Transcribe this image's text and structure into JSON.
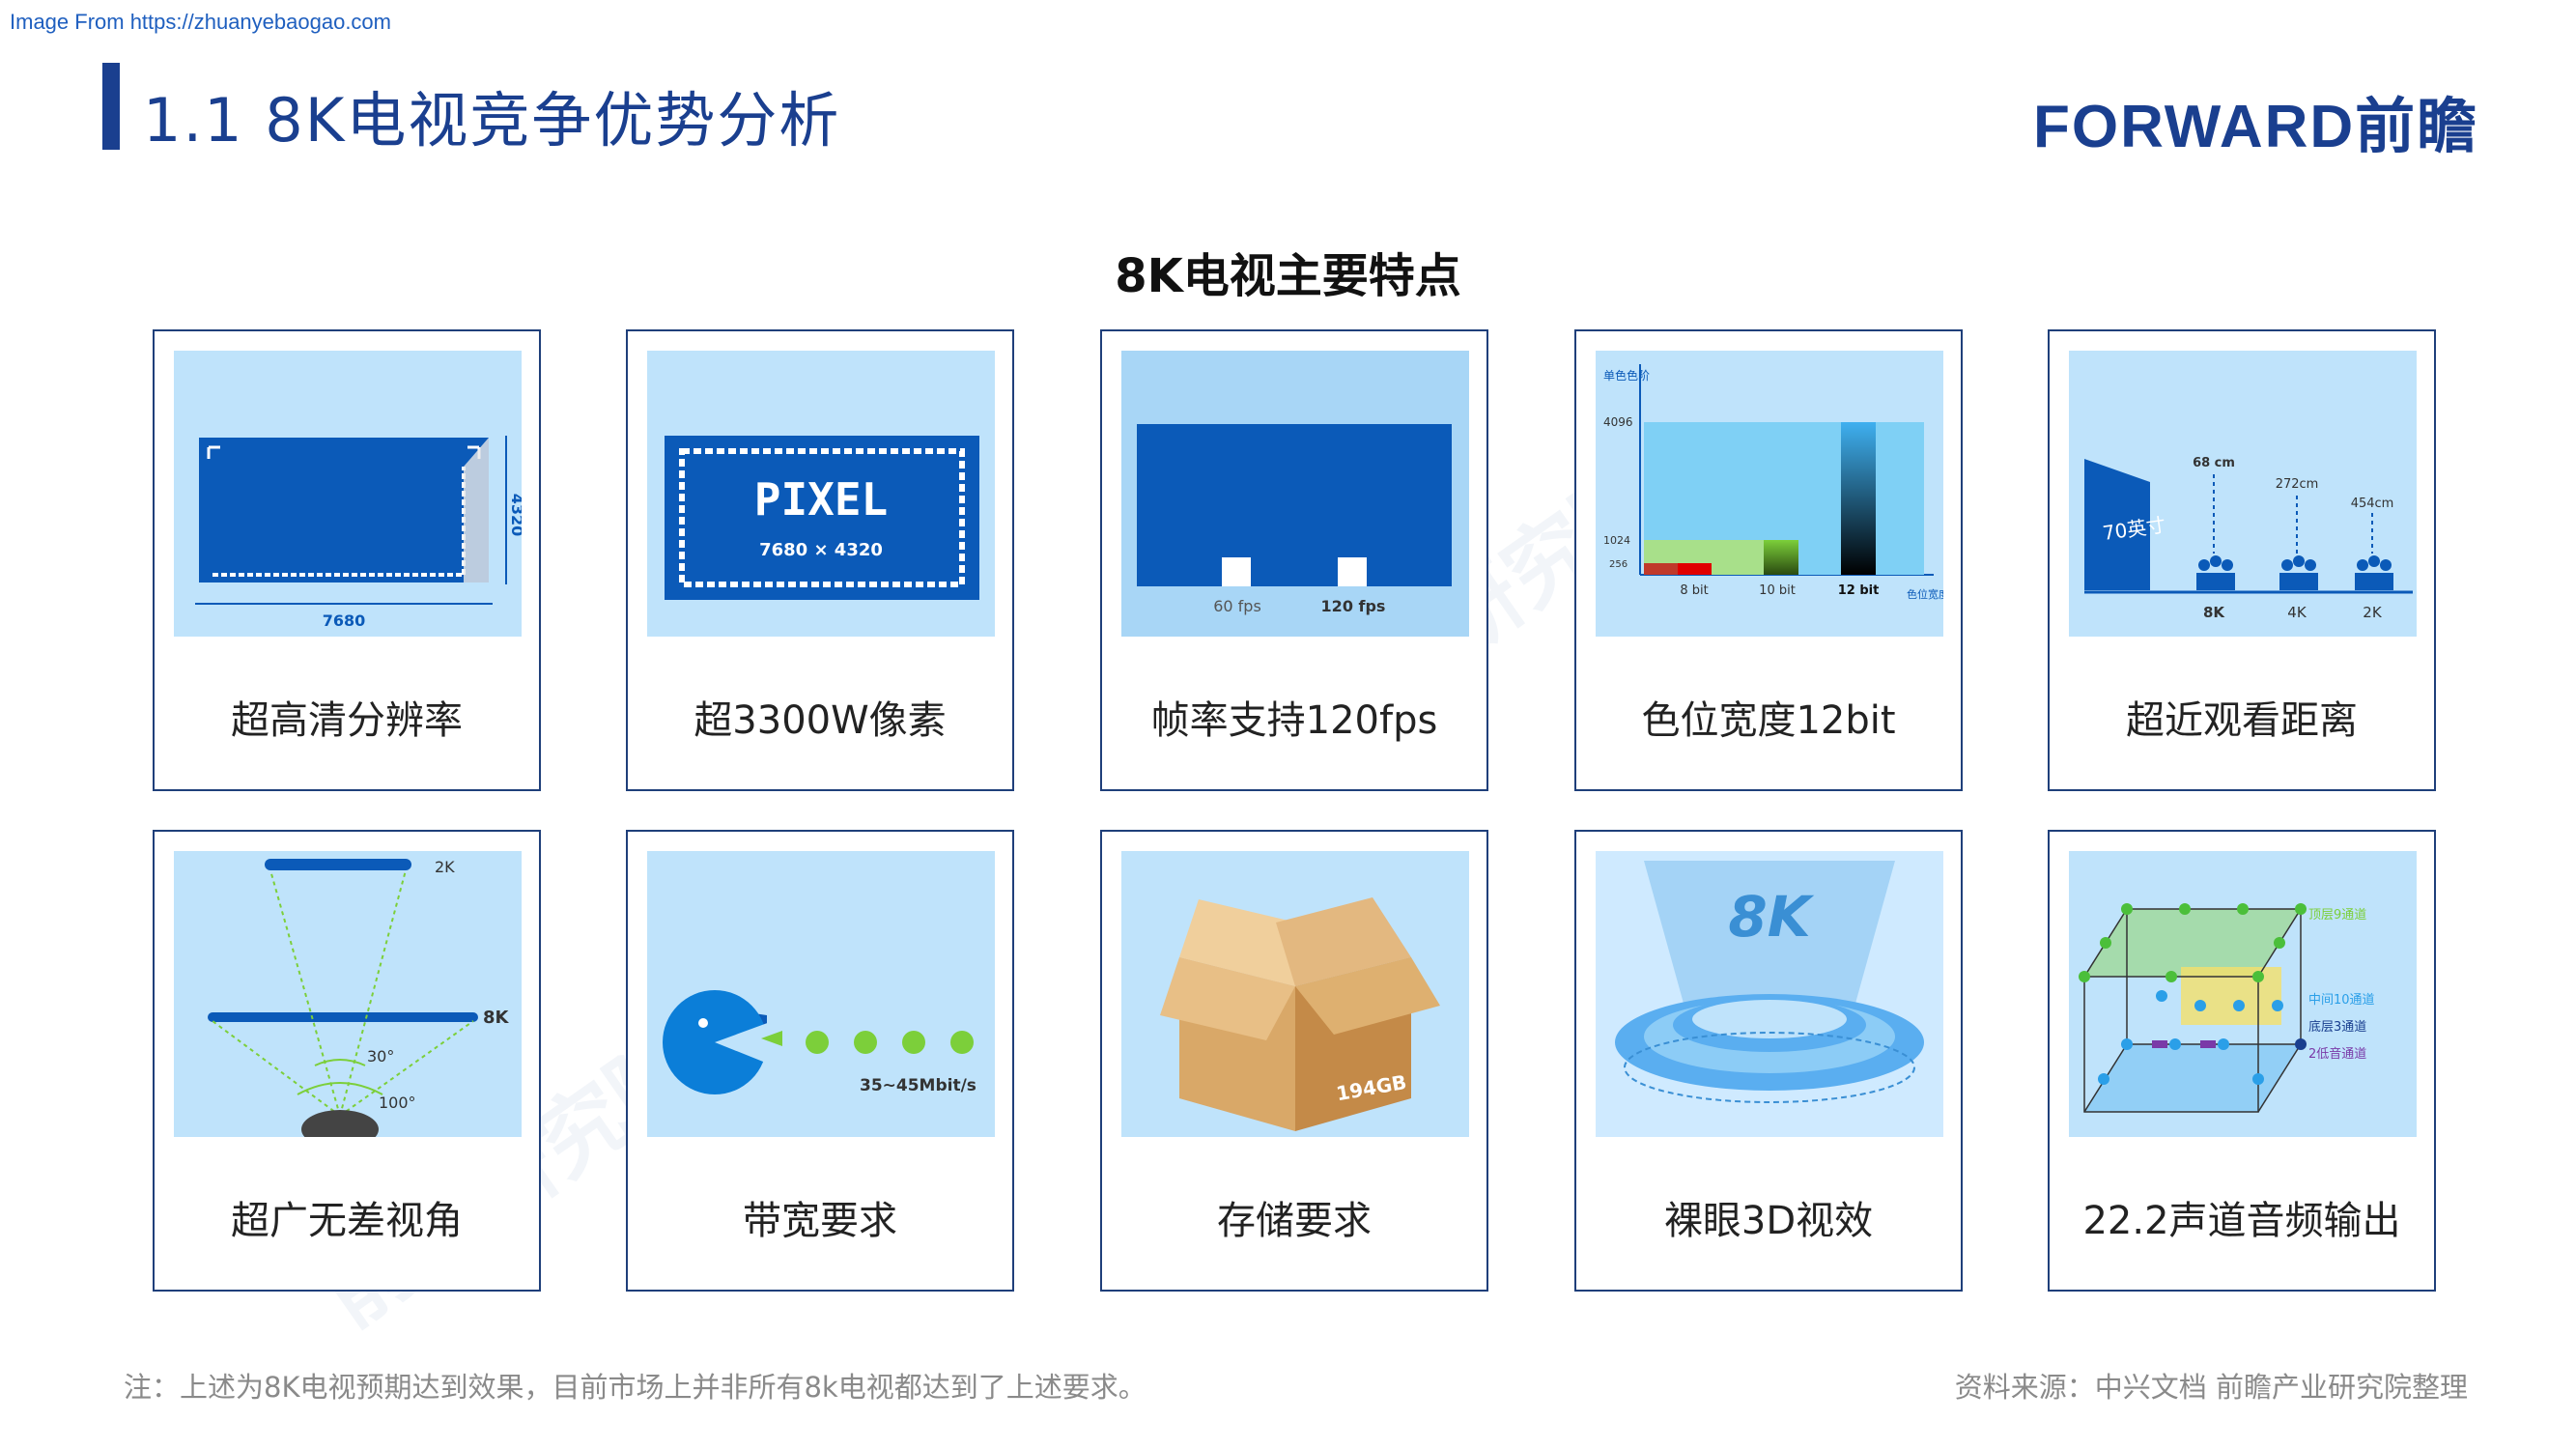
{
  "header": {
    "image_source": "Image From https://zhuanyebaogao.com",
    "title": "1.1  8K电视竞争优势分析",
    "logo": "FORWARD前瞻"
  },
  "main": {
    "title": "8K电视主要特点",
    "cards": [
      {
        "label": "超高清分辨率",
        "figure": {
          "width_text": "7680",
          "height_text": "4320"
        }
      },
      {
        "label": "超3300W像素",
        "figure": {
          "word": "PIXEL",
          "res": "7680 × 4320"
        }
      },
      {
        "label": "帧率支持120fps",
        "figure": {
          "fps_a": "60 fps",
          "fps_b": "120 fps"
        }
      },
      {
        "label": "色位宽度12bit",
        "figure": {
          "y_axis": "单色色阶",
          "y_4096": "4096",
          "y_1024": "1024",
          "y_256": "256",
          "x_a": "8 bit",
          "x_b": "10 bit",
          "x_c": "12 bit",
          "x_axis": "色位宽度"
        }
      },
      {
        "label": "超近观看距离",
        "figure": {
          "screen": "70英寸",
          "d1": "68 cm",
          "d2": "272cm",
          "d3": "454cm",
          "r1": "8K",
          "r2": "4K",
          "r3": "2K"
        }
      },
      {
        "label": "超广无差视角",
        "figure": {
          "top": "2K",
          "mid": "8K",
          "a1": "30°",
          "a2": "100°"
        }
      },
      {
        "label": "带宽要求",
        "figure": {
          "rate": "35~45Mbit/s"
        }
      },
      {
        "label": "存储要求",
        "figure": {
          "size": "194GB"
        }
      },
      {
        "label": "裸眼3D视效",
        "figure": {
          "text": "8K"
        }
      },
      {
        "label": "22.2声道音频输出",
        "figure": {
          "l1": "顶层9通道",
          "l2": "中间10通道",
          "l3": "底层3通道",
          "l4": "2低音通道"
        }
      }
    ]
  },
  "footer": {
    "note": "注：上述为8K电视预期达到效果，目前市场上并非所有8k电视都达到了上述要求。",
    "source": "资料来源：中兴文档 前瞻产业研究院整理"
  },
  "colors": {
    "brand": "#1a3f8f",
    "panel_bg": "#bfe3fb",
    "tv_blue": "#0b5ab8",
    "green": "#7ccf3a"
  }
}
